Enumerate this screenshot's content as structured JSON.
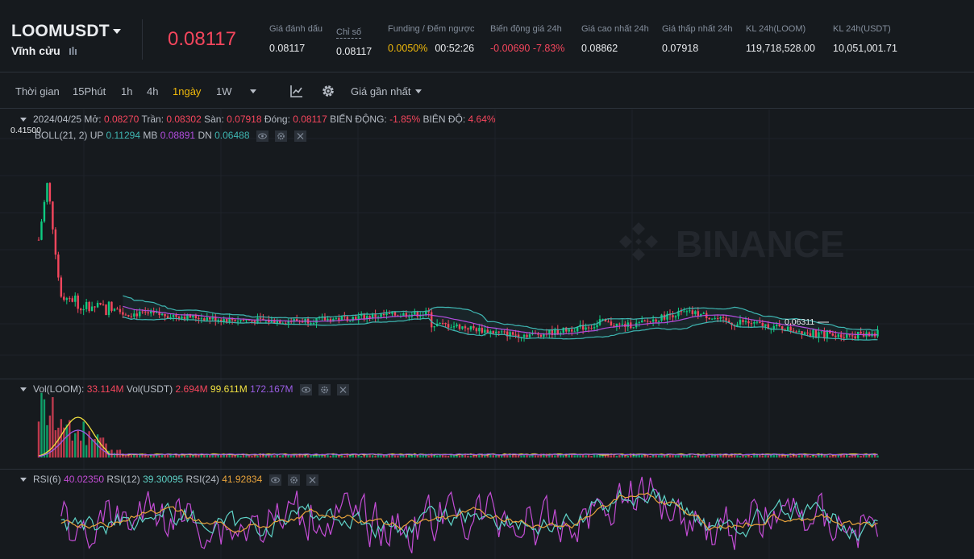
{
  "header": {
    "symbol": "LOOMUSDT",
    "contract_type": "Vĩnh cửu",
    "last_price": "0.08117",
    "stats": [
      {
        "label": "Giá đánh dấu",
        "value": "0.08117"
      },
      {
        "label": "Chỉ số",
        "value": "0.08117"
      },
      {
        "label": "Funding / Đếm ngược",
        "value": "0.0050%",
        "value2": "00:52:26"
      },
      {
        "label": "Biến động giá 24h",
        "value": "-0.00690 -7.83%"
      },
      {
        "label": "Giá cao nhất 24h",
        "value": "0.08862"
      },
      {
        "label": "Giá thấp nhất 24h",
        "value": "0.07918"
      },
      {
        "label": "KL 24h(LOOM)",
        "value": "119,718,528.00"
      },
      {
        "label": "KL 24h(USDT)",
        "value": "10,051,001.71"
      }
    ]
  },
  "toolbar": {
    "time_label": "Thời gian",
    "intervals": [
      "15Phút",
      "1h",
      "4h",
      "1ngày",
      "1W"
    ],
    "active_interval": "1ngày",
    "price_type": "Giá gần nhất",
    "icons": [
      "chart-type-icon",
      "gear-icon"
    ]
  },
  "ohlc_legend": {
    "date": "2024/04/25",
    "open_label": "Mở:",
    "open": "0.08270",
    "high_label": "Trần:",
    "high": "0.08302",
    "low_label": "Sàn:",
    "low": "0.07918",
    "close_label": "Đóng:",
    "close": "0.08117",
    "change_label": "BIẾN ĐỘNG:",
    "change": "-1.85%",
    "amp_label": "BIÊN ĐỘ:",
    "amp": "4.64%"
  },
  "boll_legend": {
    "name": "BOLL(21, 2)",
    "up_label": "UP",
    "up": "0.11294",
    "mb_label": "MB",
    "mb": "0.08891",
    "dn_label": "DN",
    "dn": "0.06488"
  },
  "vol_legend": {
    "loom_label": "Vol(LOOM):",
    "loom": "33.114M",
    "usdt_label": "Vol(USDT)",
    "usdt": "2.694M",
    "ma1": "99.611M",
    "ma2": "172.167M"
  },
  "rsi_legend": {
    "rsi6_label": "RSI(6)",
    "rsi6": "40.02350",
    "rsi12_label": "RSI(12)",
    "rsi12": "39.30095",
    "rsi24_label": "RSI(24)",
    "rsi24": "41.92834"
  },
  "chart_labels": {
    "max_price": "0.41500",
    "min_price": "0.06311",
    "watermark": "BINANCE"
  },
  "colors": {
    "up": "#0ecb81",
    "down": "#f6465d",
    "boll_up": "#3fb6b2",
    "boll_mb": "#b34ee0",
    "vol_ma1": "#f0e040",
    "vol_ma2": "#9b5de5",
    "rsi6": "#c44dd6",
    "rsi12": "#5fd3c8",
    "rsi24": "#e8a33c"
  },
  "chart_data": {
    "type": "candlestick",
    "title": "",
    "ohlc_last": {
      "date": "2024/04/25",
      "open": 0.0827,
      "high": 0.08302,
      "low": 0.07918,
      "close": 0.08117
    },
    "boll_last": {
      "up": 0.11294,
      "mb": 0.08891,
      "dn": 0.06488
    },
    "rsi_last": {
      "rsi6": 40.0235,
      "rsi12": 39.30095,
      "rsi24": 41.92834
    },
    "vol_last": {
      "loom": "33.114M",
      "usdt": "2.694M",
      "ma1": "99.611M",
      "ma2": "172.167M"
    },
    "max_price_marker": 0.415,
    "min_price_marker": 0.06311
  }
}
